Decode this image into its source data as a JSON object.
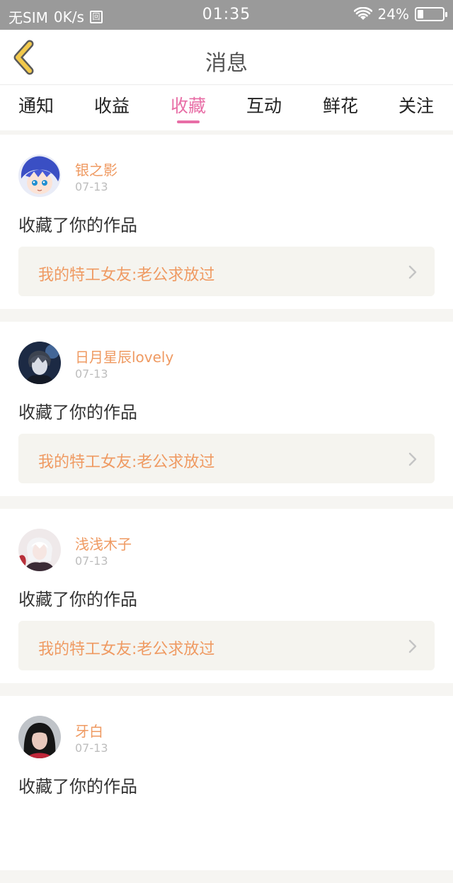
{
  "status_bar": {
    "carrier": "无SIM",
    "speed": "0K/s",
    "sim_icon_glyph": "回",
    "time": "01:35",
    "battery": "24%",
    "battery_level": 0.24,
    "icons": [
      "sim-icon",
      "wifi-icon",
      "battery-icon"
    ]
  },
  "header": {
    "title": "消息",
    "back_icon": "chevron-left-icon",
    "back_color": "#f2c94c"
  },
  "tabs": [
    {
      "label": "通知",
      "active": false
    },
    {
      "label": "收益",
      "active": false
    },
    {
      "label": "收藏",
      "active": true
    },
    {
      "label": "互动",
      "active": false
    },
    {
      "label": "鲜花",
      "active": false
    },
    {
      "label": "关注",
      "active": false
    }
  ],
  "messages": [
    {
      "username": "银之影",
      "date": "07-13",
      "action": "收藏了你的作品",
      "work_title": "我的特工女友:老公求放过"
    },
    {
      "username": "日月星辰lovely",
      "date": "07-13",
      "action": "收藏了你的作品",
      "work_title": "我的特工女友:老公求放过"
    },
    {
      "username": "浅浅木子",
      "date": "07-13",
      "action": "收藏了你的作品",
      "work_title": "我的特工女友:老公求放过"
    },
    {
      "username": "牙白",
      "date": "07-13",
      "action": "收藏了你的作品",
      "work_title": ""
    }
  ],
  "colors": {
    "accent": "#e86ea6",
    "username": "#ef9a62",
    "status_bar": "#9a9a9a"
  }
}
